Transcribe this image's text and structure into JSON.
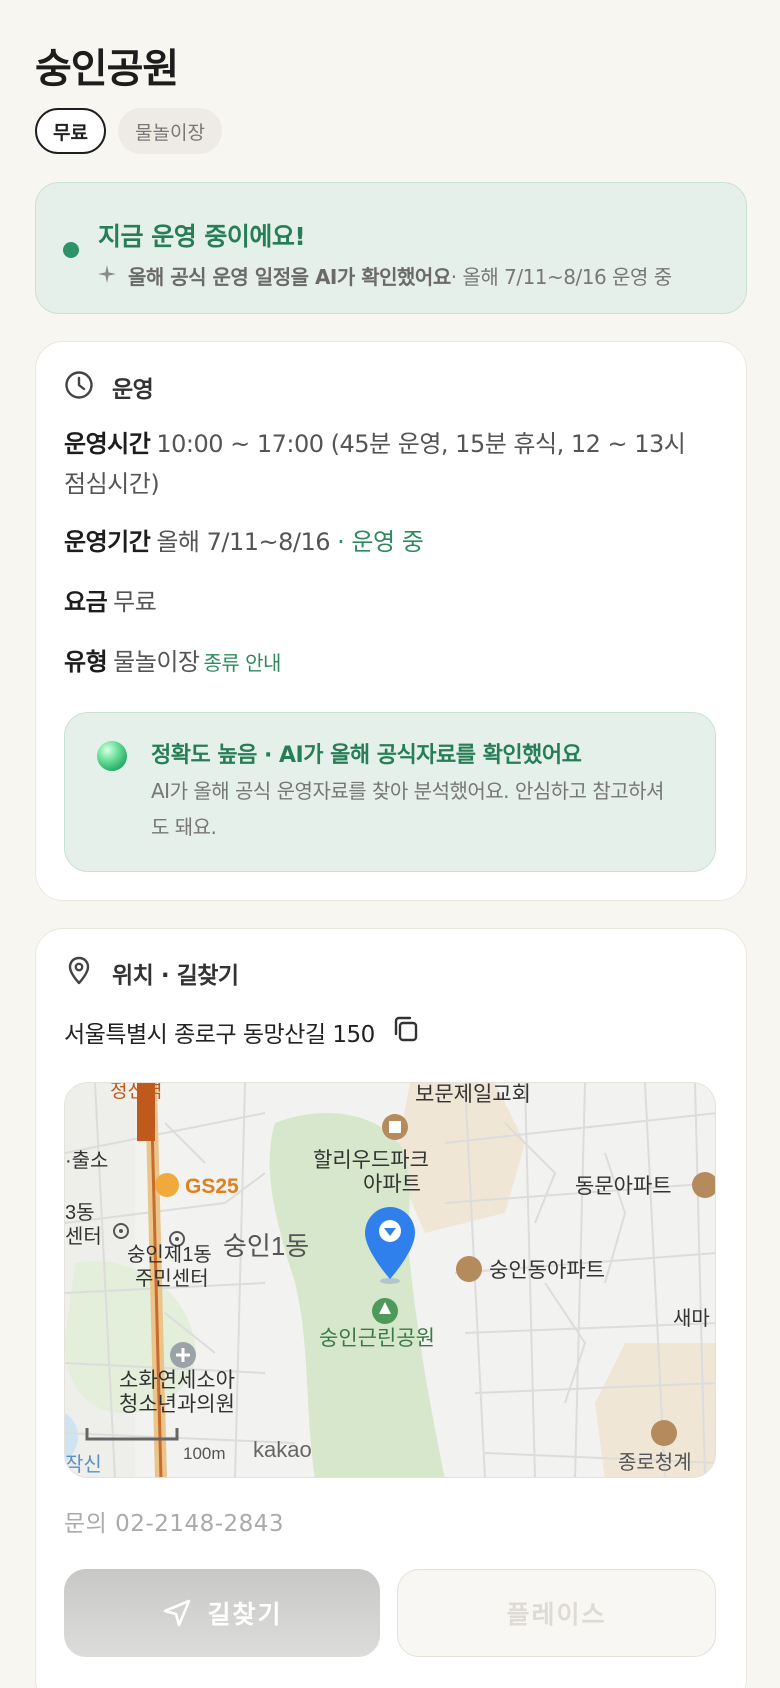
{
  "header": {
    "title": "숭인공원"
  },
  "chips": [
    {
      "label": "무료",
      "selected": true
    },
    {
      "label": "물놀이장",
      "selected": false
    }
  ],
  "status": {
    "title": "지금 운영 중이에요!",
    "subtitle_bold": "올해 공식 운영 일정을 AI가 확인했어요",
    "subtitle_rest": " · 올해 7/11~8/16 운영 중"
  },
  "operation": {
    "section_title": "운영",
    "hours_label": "운영시간",
    "hours_value": "10:00 ~ 17:00 (45분 운영, 15분 휴식, 12 ~ 13시 점심시간)",
    "period_label": "운영기간",
    "period_value": "올해 7/11~8/16",
    "period_status": " · 운영 중",
    "fee_label": "요금",
    "fee_value": "무료",
    "type_label": "유형",
    "type_value": "물놀이장",
    "type_link": "종류 안내",
    "accuracy": {
      "title": "정확도 높음 · AI가 올해 공식자료를 확인했어요",
      "body": "AI가 올해 공식 운영자료를 찾아 분석했어요. 안심하고 참고하셔도 돼요."
    }
  },
  "location": {
    "section_title": "위치 · 길찾기",
    "address": "서울특별시 종로구 동망산길 150",
    "map": {
      "labels": {
        "church": "보문제일교회",
        "apt1_line1": "할리우드파크",
        "apt1_line2": "아파트",
        "apt2": "동문아파트",
        "apt3": "숭인동아파트",
        "gs25": "GS25",
        "station_frag": "정신역",
        "police_frag": "·출소",
        "dong3_frag1": "3동",
        "dong3_frag2": "센터",
        "center_line1": "숭인제1동",
        "center_line2": "주민센터",
        "dong": "숭인1동",
        "park": "숭인근린공원",
        "clinic_line1": "소화연세소아",
        "clinic_line2": "청소년과의원",
        "new_frag": "새마",
        "office": "종로청계",
        "station_frag2": "작신",
        "scale": "100m",
        "provider": "kakao"
      }
    },
    "contact": "문의 02-2148-2843",
    "route_button": "길찾기",
    "place_button": "플레이스"
  },
  "colors": {
    "accent_green": "#277e56",
    "status_bg": "#e6f0ea",
    "pin_blue": "#2f80ed"
  }
}
